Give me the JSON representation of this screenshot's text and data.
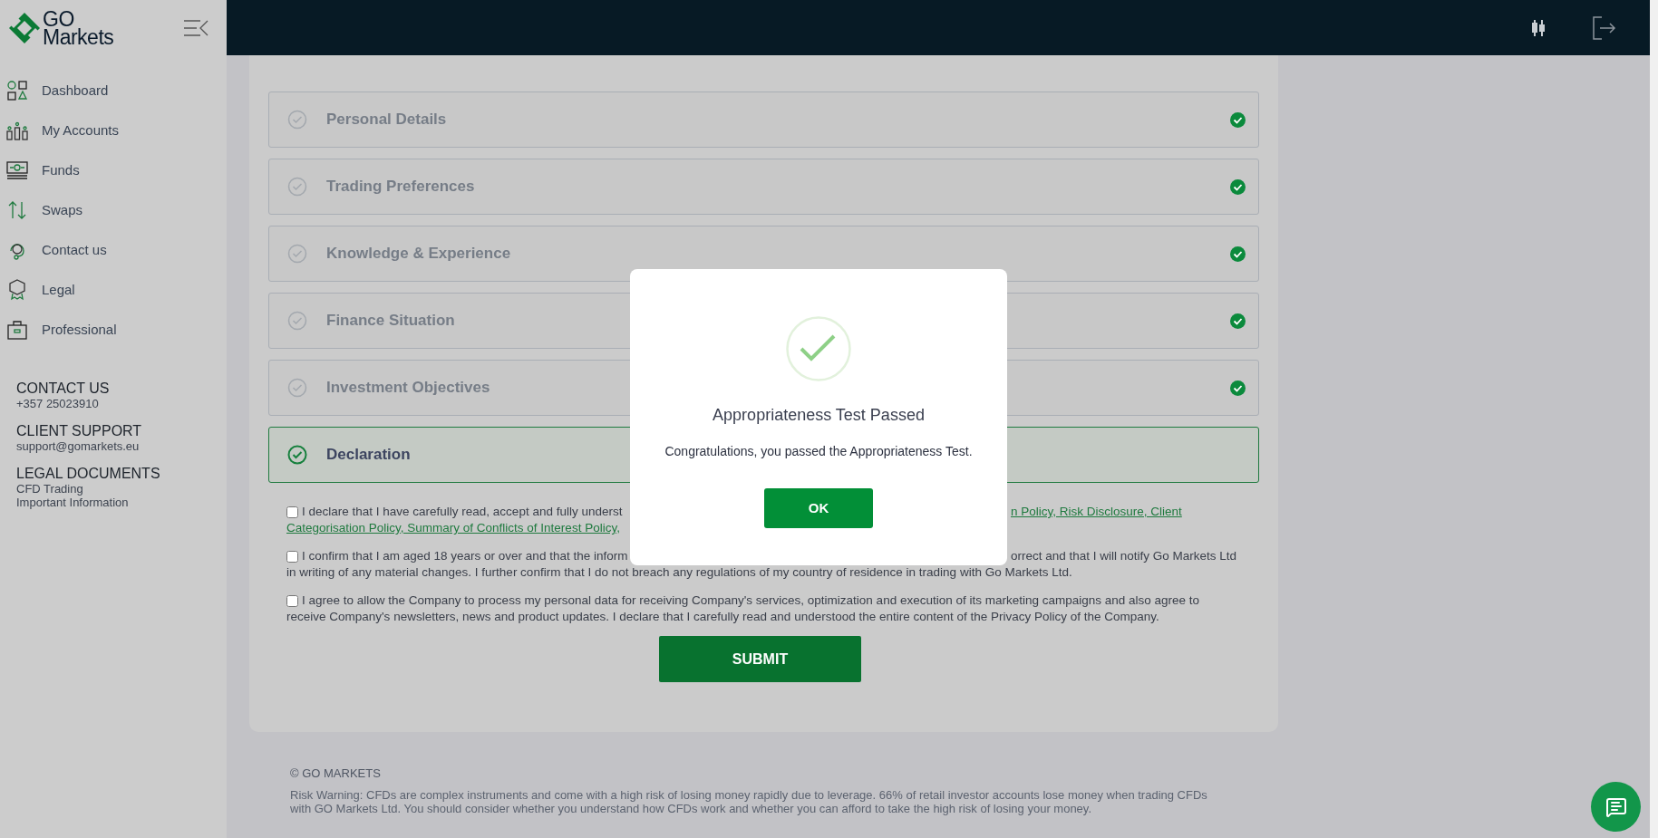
{
  "sidebar": {
    "logo": [
      "GO",
      "Markets"
    ],
    "items": [
      {
        "label": "Dashboard",
        "kind": "dashboard"
      },
      {
        "label": "My Accounts",
        "kind": "accounts"
      },
      {
        "label": "Funds",
        "kind": "funds"
      },
      {
        "label": "Swaps",
        "kind": "swaps"
      },
      {
        "label": "Contact us",
        "kind": "contact"
      },
      {
        "label": "Legal",
        "kind": "legal"
      },
      {
        "label": "Professional",
        "kind": "professional"
      }
    ],
    "info": [
      {
        "heading": "CONTACT US",
        "lines": [
          "+357 25023910"
        ]
      },
      {
        "heading": "CLIENT SUPPORT",
        "lines": [
          "support@gomarkets.eu"
        ]
      },
      {
        "heading": "LEGAL DOCUMENTS",
        "lines": [
          "CFD Trading",
          "Important Information"
        ]
      }
    ]
  },
  "steps": [
    {
      "title": "Personal Details",
      "completed": true,
      "selected": false
    },
    {
      "title": "Trading Preferences",
      "completed": true,
      "selected": false
    },
    {
      "title": "Knowledge & Experience",
      "completed": true,
      "selected": false
    },
    {
      "title": "Finance Situation",
      "completed": true,
      "selected": false
    },
    {
      "title": "Investment Objectives",
      "completed": true,
      "selected": false
    },
    {
      "title": "Declaration",
      "completed": false,
      "selected": true
    }
  ],
  "declarations": [
    {
      "checked": false,
      "lines": [
        {
          "left": {
            "text": "I declare that I have carefully read, accept and fully underst",
            "link": false
          },
          "right": {
            "text": "n Policy, Risk Disclosure, Client",
            "link": true
          }
        },
        {
          "left": {
            "text": "Categorisation Policy, Summary of Conflicts of Interest Policy,",
            "link": true
          }
        }
      ]
    },
    {
      "checked": false,
      "lines": [
        {
          "left": {
            "text": "I confirm that I am aged 18 years or over and that the inform",
            "link": false
          },
          "right": {
            "text": "orrect and that I will notify Go Markets Ltd",
            "link": false
          }
        },
        {
          "left": {
            "text": "in writing of any material changes. I further confirm that I do not breach any regulations of my country of residence in trading with Go Markets Ltd.",
            "link": false
          }
        }
      ]
    },
    {
      "checked": false,
      "lines": [
        {
          "left": {
            "text": "I agree to allow the Company to process my personal data for receiving Company's services, optimization and execution of its marketing campaigns and also agree to",
            "link": false
          }
        },
        {
          "left": {
            "text": "receive Company's newsletters, news and product updates. I declare that I carefully read and understood the entire content of the Privacy Policy of the Company.",
            "link": false
          }
        }
      ]
    }
  ],
  "submit": "SUBMIT",
  "footer": {
    "copyright": "© GO MARKETS",
    "risk_warning": "Risk Warning: CFDs are complex instruments and come with a high risk of losing money rapidly due to leverage. 66% of retail investor accounts lose money when trading CFDs with GO Markets Ltd. You should consider whether you understand how CFDs work and whether you can afford to take the high risk of losing your money."
  },
  "modal": {
    "title": "Appropriateness Test Passed",
    "message": "Congratulations, you passed the Appropriateness Test.",
    "button": "OK"
  }
}
